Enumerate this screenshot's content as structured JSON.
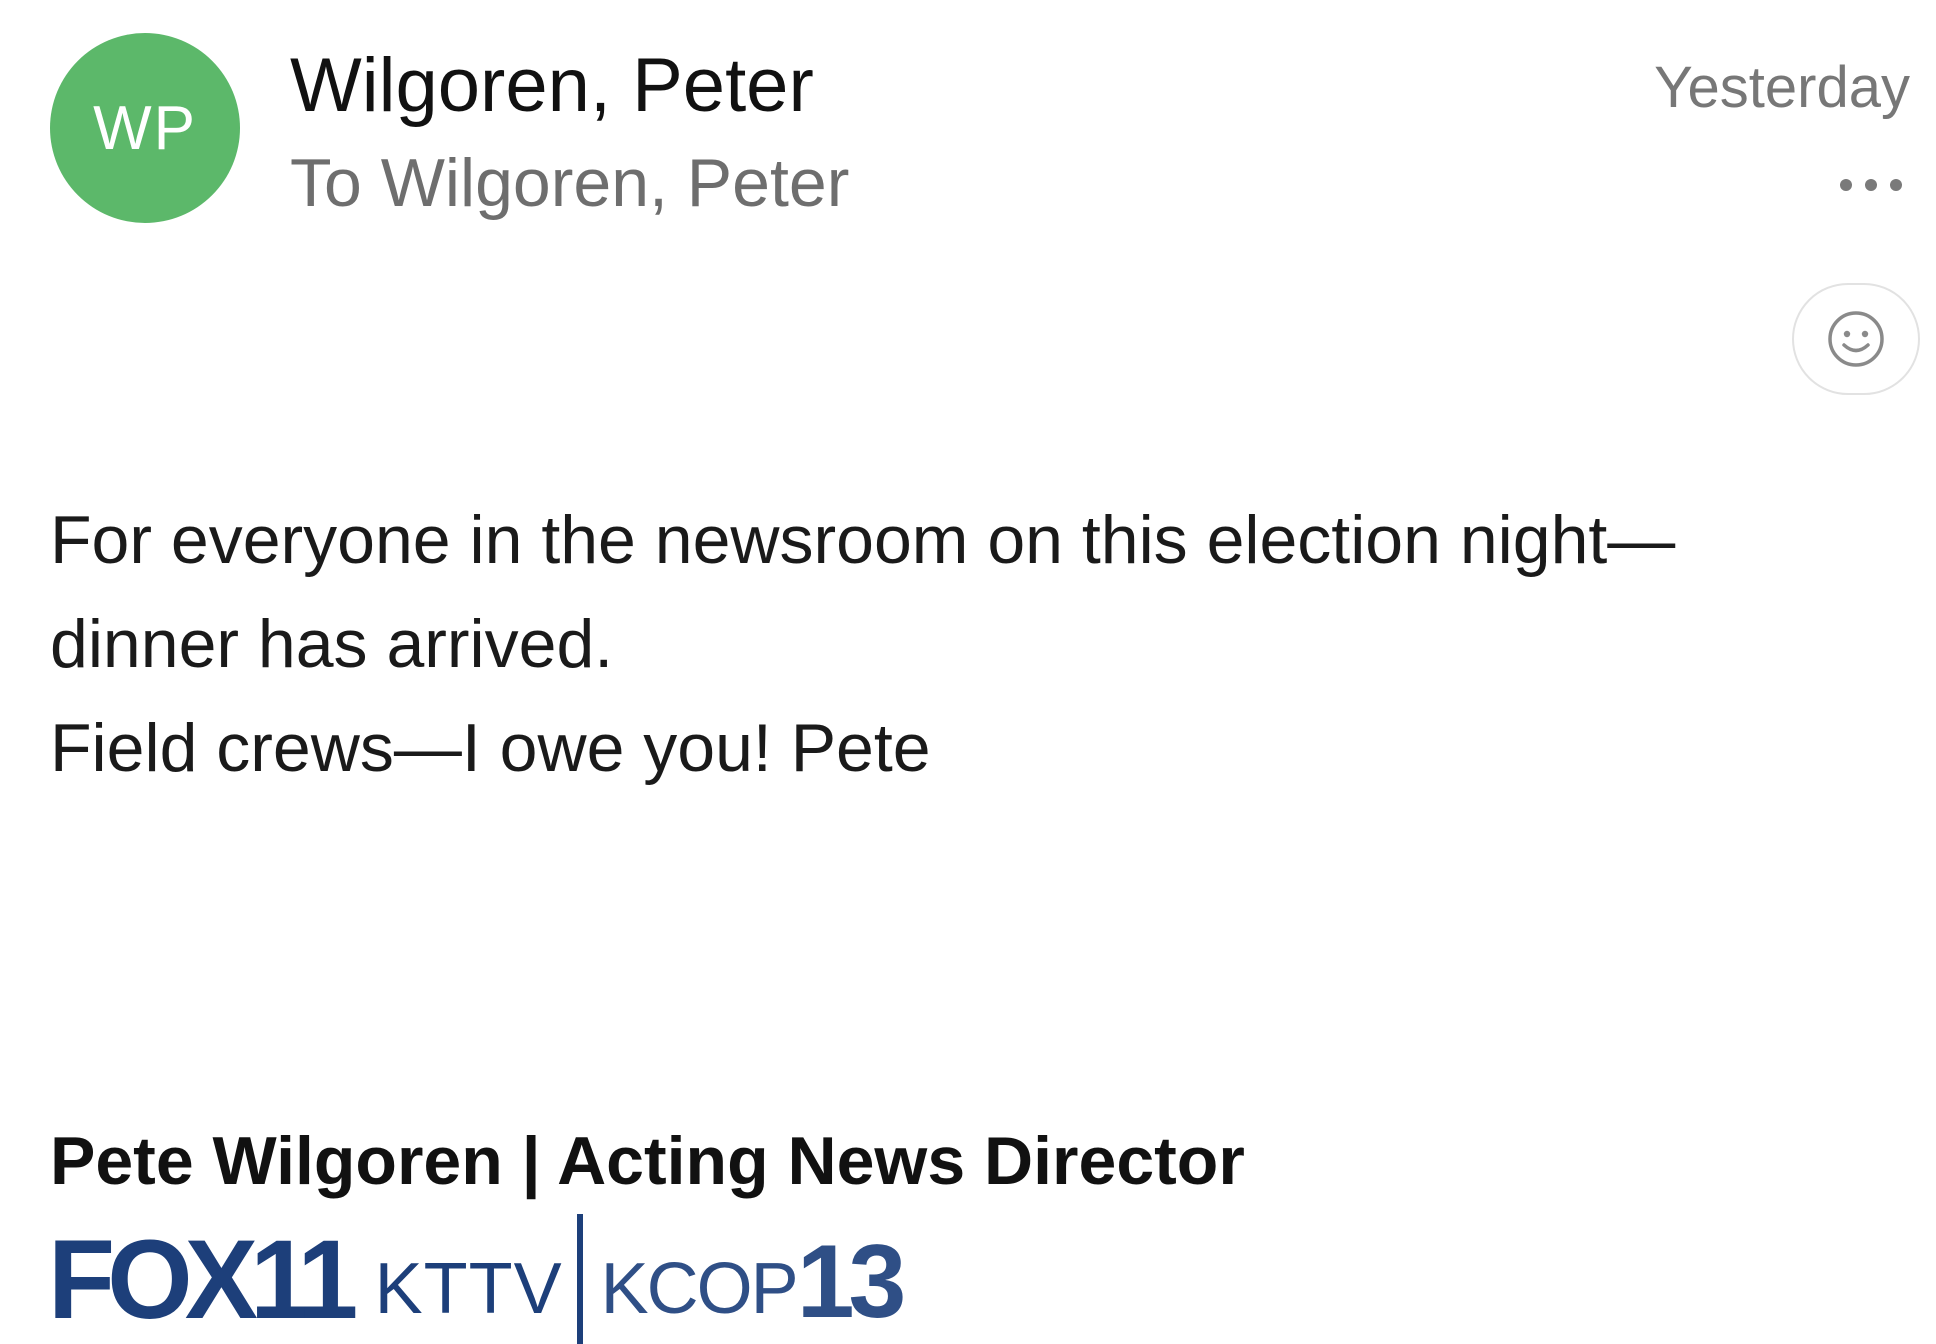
{
  "email": {
    "avatar_initials": "WP",
    "avatar_color": "#5cb86a",
    "sender_name": "Wilgoren, Peter",
    "recipient_line": "To Wilgoren, Peter",
    "timestamp": "Yesterday",
    "more_icon": "more-horizontal-icon",
    "react_icon": "smiley-icon",
    "body_lines": [
      "For everyone in the newsroom on this election night—",
      "dinner has arrived.",
      "Field crews—I owe you!  Pete"
    ],
    "signature": "Pete Wilgoren | Acting News Director",
    "logo": {
      "fox": "FOX11",
      "kttv": "KTTV",
      "kcop": "KCOP",
      "channel": "13",
      "color": "#1d3f7a"
    }
  }
}
